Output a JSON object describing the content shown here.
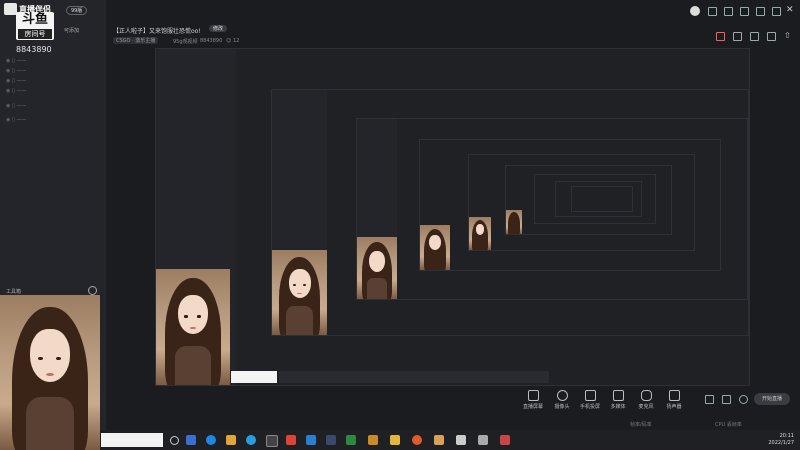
{
  "app": {
    "logo_text": "直播伴侣",
    "version_badge": "99版",
    "stamp_top": "斗鱼",
    "stamp_bottom": "房间号",
    "room_id": "8843890",
    "scene_label": "可添加"
  },
  "header": {
    "title": "【正人啦子】又来饱服壮恐慌oo!",
    "edit_label": "修改",
    "category_chip": "CSGO · 激乐主播",
    "meta_1": "95g观视频",
    "meta_2": "8843890",
    "viewer_count": "12"
  },
  "toolbox_label": "工具箱",
  "toolbar": {
    "buttons": [
      {
        "label": "直播屏幕",
        "icon": "screen-icon"
      },
      {
        "label": "摄像头",
        "icon": "camera-icon"
      },
      {
        "label": "手机投屏",
        "icon": "phone-cast-icon"
      },
      {
        "label": "多媒体",
        "icon": "media-icon"
      },
      {
        "label": "麦克风",
        "icon": "mic-icon"
      },
      {
        "label": "扬声器",
        "icon": "speaker-icon"
      }
    ],
    "start_live": "开始直播"
  },
  "status": {
    "left": "帧率/码率",
    "right": "CPU 丢帧率"
  },
  "taskbar": {
    "time": "20:11",
    "date": "2022/1/27"
  },
  "colors": {
    "bg": "#1b1c1f",
    "sidebar": "#24252a",
    "accent": "#ff5a5a"
  }
}
